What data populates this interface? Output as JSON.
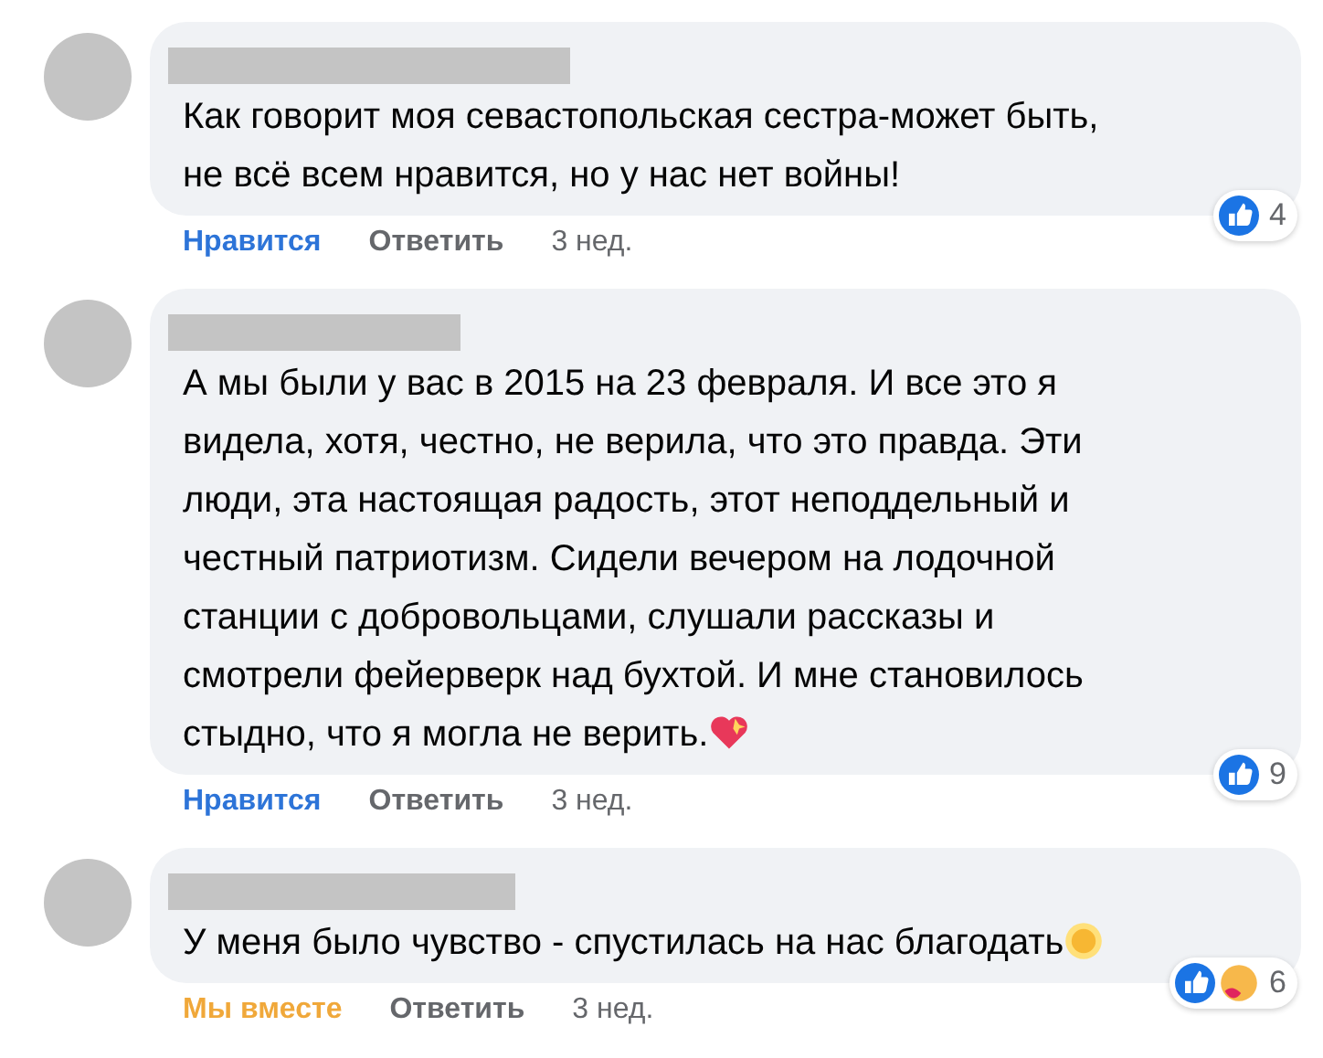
{
  "comments": [
    {
      "text_lines": [
        "Как говорит моя севастопольская сестра-может быть,",
        "не всё всем нравится, но у нас нет войны!"
      ],
      "reaction_action": {
        "label": "Нравится",
        "kind": "like"
      },
      "reply": "Ответить",
      "time": "3 нед.",
      "reactions": [
        {
          "kind": "like"
        }
      ],
      "reaction_count": "4"
    },
    {
      "text_lines": [
        "А мы были у вас в 2015 на 23 февраля. И все это я",
        "видела, хотя, честно, не верила, что это правда. Эти",
        "люди, эта настоящая радость, этот неподдельный и",
        "честный патриотизм. Сидели вечером на лодочной",
        "станции с добровольцами, слушали рассказы и",
        "смотрели фейерверк над бухтой. И мне становилось",
        "стыдно, что я могла не верить."
      ],
      "end_emoji": {
        "kind": "heart"
      },
      "reaction_action": {
        "label": "Нравится",
        "kind": "like"
      },
      "reply": "Ответить",
      "time": "3 нед.",
      "reactions": [
        {
          "kind": "like"
        }
      ],
      "reaction_count": "9"
    },
    {
      "text_lines": [
        "У меня было чувство - спустилась на нас благодать"
      ],
      "end_emoji": {
        "kind": "sun"
      },
      "reaction_action": {
        "label": "Мы вместе",
        "kind": "care"
      },
      "reply": "Ответить",
      "time": "3 нед.",
      "reactions": [
        {
          "kind": "like"
        },
        {
          "kind": "care"
        }
      ],
      "reaction_count": "6"
    }
  ]
}
